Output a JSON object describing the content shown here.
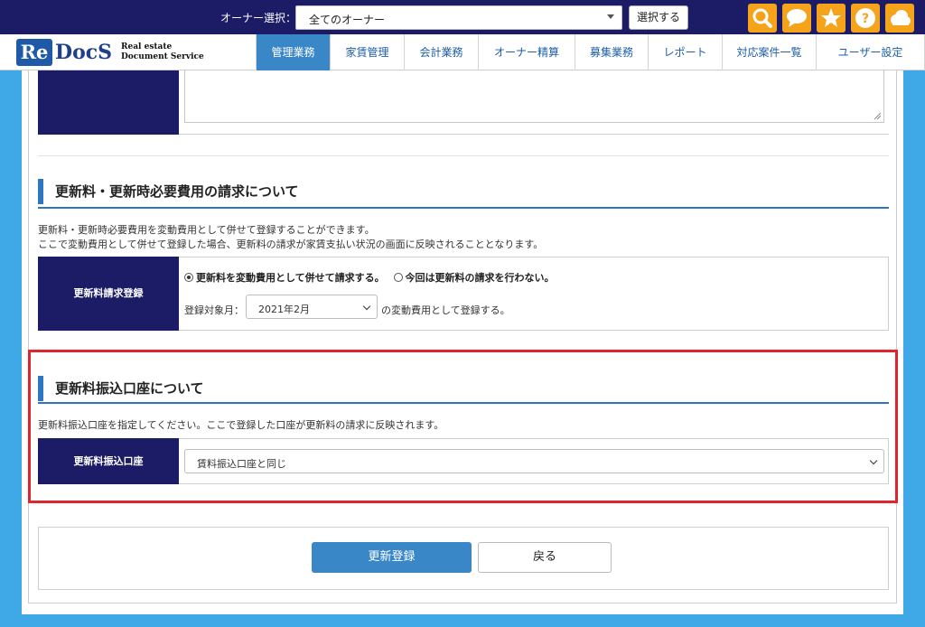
{
  "header": {
    "owner_label": "オーナー選択：",
    "owner_value": "全てのオーナー",
    "select_button": "選択する",
    "tools": [
      {
        "icon": "search-icon"
      },
      {
        "icon": "chat-icon"
      },
      {
        "icon": "star-icon"
      },
      {
        "icon": "help-icon"
      },
      {
        "icon": "cloud-icon"
      }
    ]
  },
  "logo": {
    "re": "Re",
    "docs": "DocS",
    "sub1": "Real estate",
    "sub2": "Document Service"
  },
  "nav": {
    "tabs": [
      {
        "label": "管理業務",
        "active": true
      },
      {
        "label": "家賃管理"
      },
      {
        "label": "会計業務"
      },
      {
        "label": "オーナー精算"
      },
      {
        "label": "募集業務"
      },
      {
        "label": "レポート"
      },
      {
        "label": "対応案件一覧"
      },
      {
        "label": "ユーザー設定"
      }
    ]
  },
  "renewal_fee": {
    "title": "更新料・更新時必要費用の請求について",
    "desc1": "更新料・更新時必要費用を変動費用として併せて登録することができます。",
    "desc2": "ここで変動費用として併せて登録した場合、更新料の請求が家賃支払い状況の画面に反映されることとなります。",
    "row_label": "更新料請求登録",
    "option1": "更新料を変動費用として併せて請求する。",
    "option2": "今回は更新料の請求を行わない。",
    "month_label": "登録対象月：",
    "month_value": "2021年2月",
    "month_suffix": "の変動費用として登録する。"
  },
  "renewal_account": {
    "title": "更新料振込口座について",
    "desc": "更新料振込口座を指定してください。ここで登録した口座が更新料の請求に反映されます。",
    "row_label": "更新料振込口座",
    "select_value": "賃料振込口座と同じ"
  },
  "actions": {
    "submit": "更新登録",
    "back": "戻る"
  },
  "colors": {
    "header_bg": "#1b1b66",
    "accent": "#3a87c8",
    "tool_orange": "#f5a31a",
    "highlight": "#e0262b",
    "page_bg": "#3fa9e8"
  }
}
